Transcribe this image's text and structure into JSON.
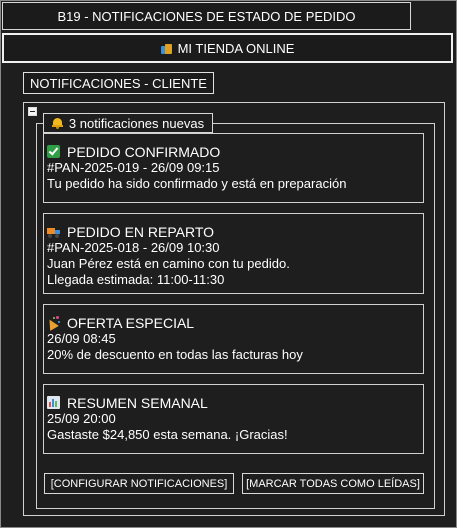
{
  "window": {
    "title": "B19 - NOTIFICACIONES DE ESTADO DE PEDIDO"
  },
  "store": {
    "icon": "shopping-bags-icon",
    "name": "MI TIENDA ONLINE"
  },
  "section": {
    "label": "NOTIFICACIONES - CLIENTE"
  },
  "group": {
    "icon": "bell-icon",
    "legend": "3 notificaciones nuevas"
  },
  "notifications": [
    {
      "icon": "check-mark-icon",
      "title": "PEDIDO CONFIRMADO",
      "lines": [
        "#PAN-2025-019 - 26/09 09:15",
        "Tu pedido ha sido confirmado y está en preparación"
      ]
    },
    {
      "icon": "delivery-truck-icon",
      "title": "PEDIDO EN REPARTO",
      "lines": [
        "#PAN-2025-018 - 26/09 10:30",
        "Juan Pérez está en camino con tu pedido.",
        "Llegada estimada: 11:00-11:30"
      ]
    },
    {
      "icon": "party-popper-icon",
      "title": "OFERTA ESPECIAL",
      "lines": [
        "26/09 08:45",
        "20% de descuento en todas las facturas hoy"
      ]
    },
    {
      "icon": "bar-chart-icon",
      "title": "RESUMEN SEMANAL",
      "lines": [
        "25/09 20:00",
        "Gastaste $24,850 esta semana. ¡Gracias!"
      ]
    }
  ],
  "actions": {
    "configure_label": "[CONFIGURAR NOTIFICACIONES]",
    "mark_all_label": "[MARCAR TODAS COMO LEÍDAS]"
  }
}
